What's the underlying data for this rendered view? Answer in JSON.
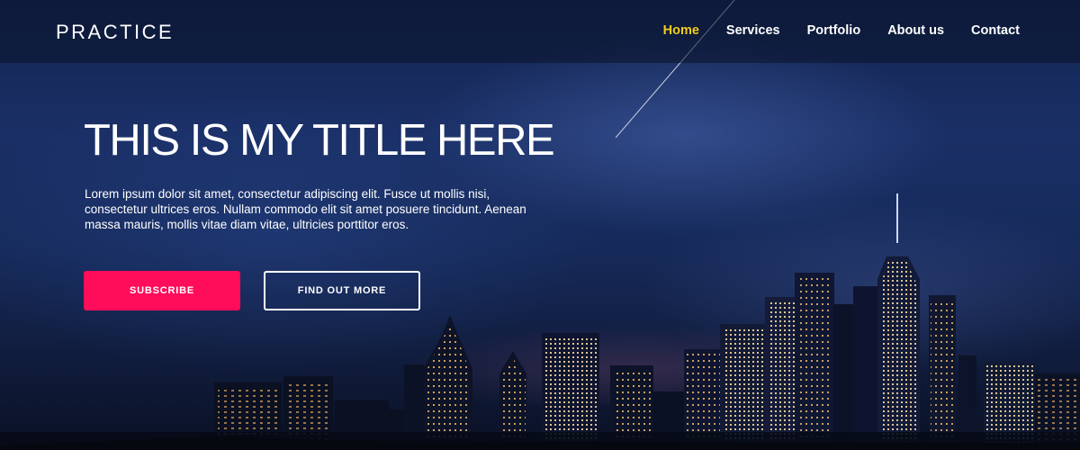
{
  "brand": {
    "logo_text": "PRACTICE"
  },
  "nav": {
    "items": [
      {
        "label": "Home",
        "active": true
      },
      {
        "label": "Services",
        "active": false
      },
      {
        "label": "Portfolio",
        "active": false
      },
      {
        "label": "About us",
        "active": false
      },
      {
        "label": "Contact",
        "active": false
      }
    ],
    "active_color": "#f2cc1a"
  },
  "hero": {
    "title": "THIS IS MY TITLE HERE",
    "description": "Lorem ipsum dolor sit amet, consectetur adipiscing elit. Fusce ut mollis nisi, consectetur ultrices eros. Nullam commodo elit sit amet posuere tincidunt. Aenean massa mauris, mollis vitae diam vitae, ultricies porttitor eros."
  },
  "buttons": {
    "subscribe_label": "SUBSCRIBE",
    "find_out_more_label": "FIND OUT MORE",
    "subscribe_color": "#ff0c5a"
  },
  "colors": {
    "sky_top": "#142552",
    "sky_bottom": "#0a1124",
    "accent": "#ff0c5a"
  }
}
